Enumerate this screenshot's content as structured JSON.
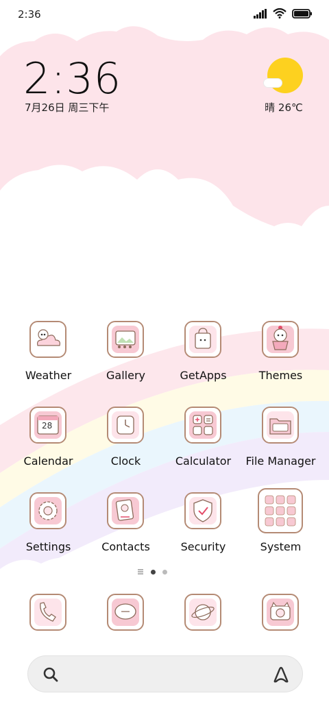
{
  "status_bar": {
    "time": "2:36"
  },
  "clock_widget": {
    "time": "2:36",
    "date": "7月26日 周三下午"
  },
  "weather_widget": {
    "text": "晴 26℃"
  },
  "apps": [
    {
      "label": "Weather",
      "icon": "panda-cloud-icon"
    },
    {
      "label": "Gallery",
      "icon": "picture-frame-icon"
    },
    {
      "label": "GetApps",
      "icon": "shopping-bag-icon"
    },
    {
      "label": "Themes",
      "icon": "panda-cupcake-icon"
    },
    {
      "label": "Calendar",
      "icon": "calendar-icon",
      "day": "28"
    },
    {
      "label": "Clock",
      "icon": "clock-icon"
    },
    {
      "label": "Calculator",
      "icon": "calculator-icon"
    },
    {
      "label": "File Manager",
      "icon": "folder-icon"
    },
    {
      "label": "Settings",
      "icon": "gear-icon"
    },
    {
      "label": "Contacts",
      "icon": "address-book-icon"
    },
    {
      "label": "Security",
      "icon": "shield-icon"
    },
    {
      "label": "System",
      "icon": "folder-grid-icon"
    }
  ],
  "dock": [
    {
      "icon": "phone-icon"
    },
    {
      "icon": "message-icon"
    },
    {
      "icon": "browser-planet-icon"
    },
    {
      "icon": "camera-icon"
    }
  ],
  "colors": {
    "pink": "#fde4ea",
    "icon_pink": "#f7c9d3",
    "icon_border": "#b48a74",
    "sun": "#fdd11f"
  }
}
